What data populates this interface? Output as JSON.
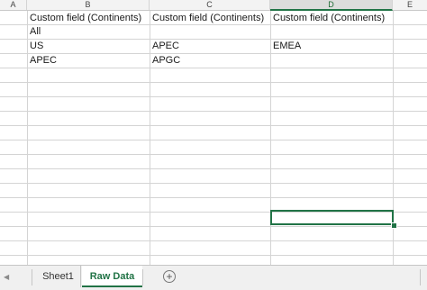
{
  "columns": [
    "A",
    "B",
    "C",
    "D",
    "E"
  ],
  "active_column": "D",
  "cells": {
    "B1": "Custom field (Continents)",
    "C1": "Custom field (Continents)",
    "D1": "Custom field (Continents)",
    "B2": "All",
    "B3": "US",
    "C3": "APEC",
    "D3": "EMEA",
    "B4": "APEC",
    "C4": "APGC"
  },
  "sheet_tabs": [
    {
      "label": "Sheet1",
      "active": false
    },
    {
      "label": "Raw Data",
      "active": true
    }
  ],
  "add_sheet_label": "+",
  "colors": {
    "accent": "#217346"
  }
}
